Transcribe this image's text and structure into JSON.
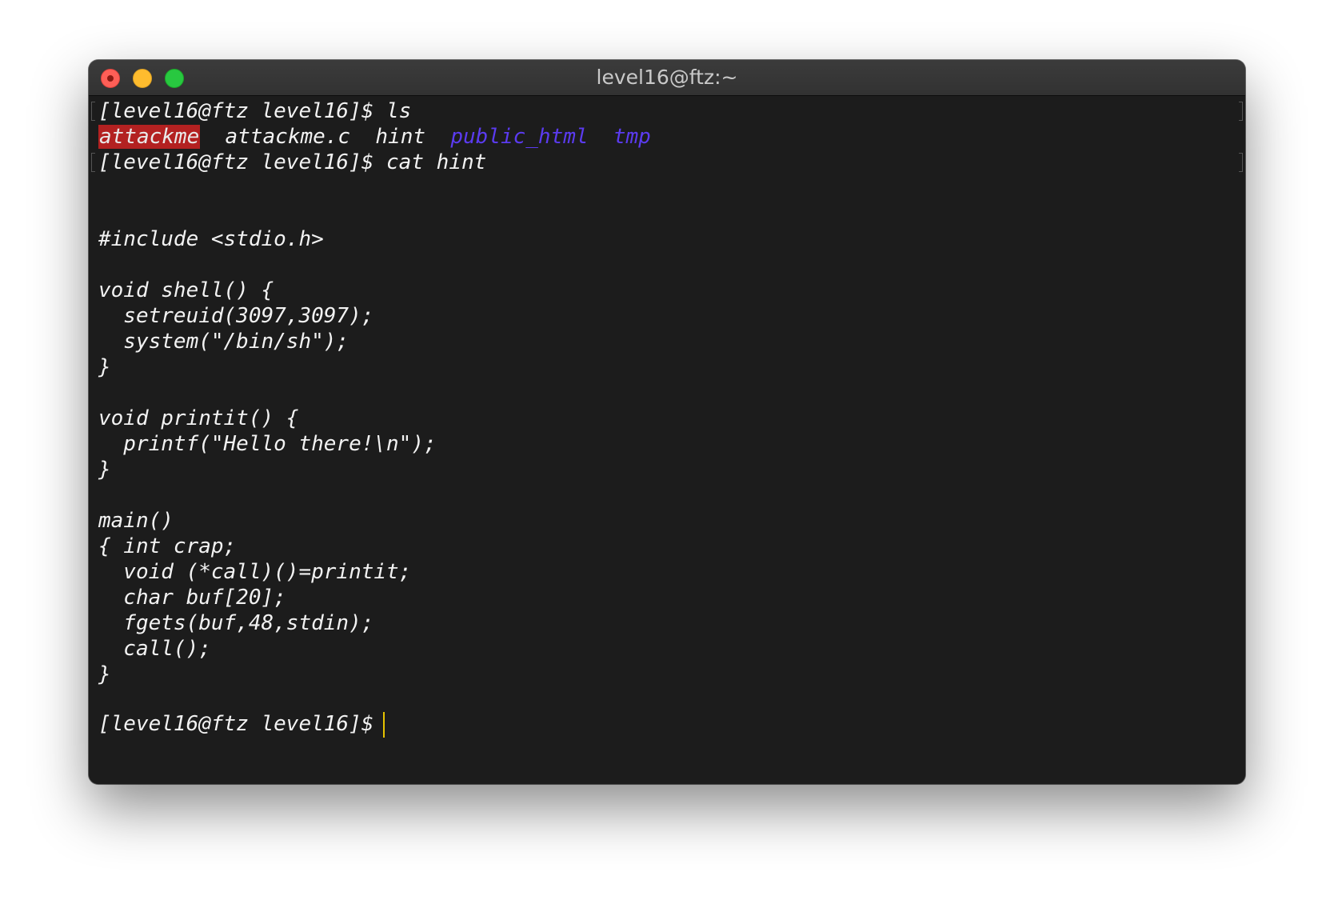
{
  "window": {
    "title": "level16@ftz:~"
  },
  "terminal": {
    "prompt1": "[level16@ftz level16]$ ls",
    "ls_output": {
      "executable": "attackme",
      "file1": "attackme.c",
      "file2": "hint",
      "dir1": "public_html",
      "dir2": "tmp"
    },
    "prompt2": "[level16@ftz level16]$ cat hint",
    "code_lines": [
      "#include <stdio.h>",
      "",
      "void shell() {",
      "  setreuid(3097,3097);",
      "  system(\"/bin/sh\");",
      "}",
      "",
      "void printit() {",
      "  printf(\"Hello there!\\n\");",
      "}",
      "",
      "main()",
      "{ int crap;",
      "  void (*call)()=printit;",
      "  char buf[20];",
      "  fgets(buf,48,stdin);",
      "  call();",
      "}"
    ],
    "final_prompt": "[level16@ftz level16]$"
  },
  "colors": {
    "background": "#1c1c1c",
    "text": "#f2f2f2",
    "executable_bg": "#b32121",
    "directory": "#5b3bf0",
    "cursor": "#e6c200",
    "close": "#fe5f57",
    "minimize": "#febc2e",
    "maximize": "#28c840"
  },
  "icons": {
    "close": "close-dot-icon",
    "minimize": "minimize-dot-icon",
    "maximize": "maximize-dot-icon"
  }
}
